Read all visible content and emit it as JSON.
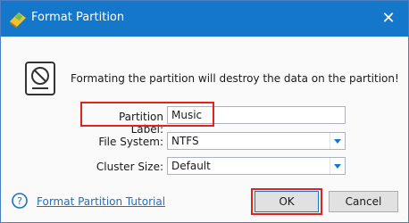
{
  "window": {
    "title": "Format Partition"
  },
  "message": "Formating the partition will destroy the data on the partition!",
  "fields": {
    "partition_label": {
      "label": "Partition Label:",
      "value": "Music"
    },
    "file_system": {
      "label": "File System:",
      "value": "NTFS"
    },
    "cluster_size": {
      "label": "Cluster Size:",
      "value": "Default"
    }
  },
  "footer": {
    "tutorial_link": "Format Partition Tutorial",
    "ok": "OK",
    "cancel": "Cancel"
  },
  "colors": {
    "titlebar": "#1477c9",
    "highlight": "#e2231a",
    "link": "#1f6fc6"
  },
  "icons": {
    "app": "format-app-icon",
    "close": "close-icon",
    "disk": "disk-warning-icon",
    "help": "help-icon"
  }
}
